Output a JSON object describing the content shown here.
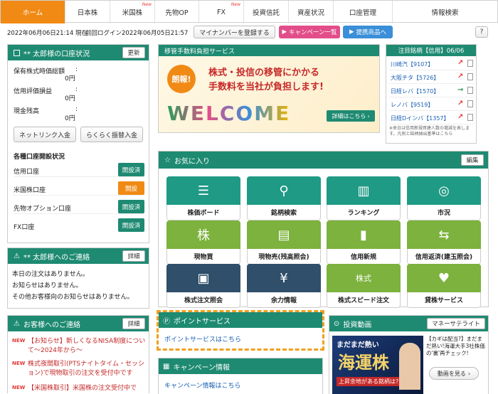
{
  "nav": {
    "tabs": [
      {
        "label": "ホーム",
        "new": ""
      },
      {
        "label": "日本株",
        "new": ""
      },
      {
        "label": "米国株",
        "new": "New"
      },
      {
        "label": "先物OP",
        "new": ""
      },
      {
        "label": "FX",
        "new": "New"
      },
      {
        "label": "投資信託",
        "new": ""
      },
      {
        "label": "資産状況",
        "new": ""
      },
      {
        "label": "口座管理",
        "new": ""
      },
      {
        "label": "情報検索",
        "new": ""
      }
    ]
  },
  "status": {
    "datetime": "2022年06月06日21:14 現在",
    "last_login": "前回ログイン2022年06月05日21:57"
  },
  "header_buttons": {
    "mynumber": "マイナンバーを登録する",
    "campaign": "キャンペーン一覧",
    "partner": "提携商品へ",
    "help": "?"
  },
  "account": {
    "title": "** 太郎様の口座状況",
    "refresh": "更新",
    "rows": [
      {
        "label": "保有株式時価総額",
        "value": "0円"
      },
      {
        "label": "信用評価損益",
        "value": "0円"
      },
      {
        "label": "現金残高",
        "value": "0円"
      }
    ],
    "btn_netlink": "ネットリンク入金",
    "btn_easy": "らくらく振替入金",
    "open_title": "各種口座開設状況",
    "open_rows": [
      {
        "label": "信用口座",
        "status": "開設済",
        "color": "#1e8a72"
      },
      {
        "label": "米国株口座",
        "status": "開設",
        "color": "#f08a15"
      },
      {
        "label": "先物オプション口座",
        "status": "開設済",
        "color": "#1e8a72"
      },
      {
        "label": "FX口座",
        "status": "開設済",
        "color": "#1e8a72"
      }
    ]
  },
  "contact": {
    "title": "** 太郎様へのご連絡",
    "detail": "詳細",
    "lines": [
      "本日の注文はありません。",
      "お知らせはありません。",
      "その他お客様向のお知らせはありません。"
    ]
  },
  "customer": {
    "title": "お客様へのご連絡",
    "detail": "詳細",
    "items": [
      {
        "tag": "NEW",
        "text": "【お知らせ】新しくなるNISA制度について～2024年から～"
      },
      {
        "tag": "NEW",
        "text": "株式夜間取引(PTSナイトタイム・セッション)で現物取引の注文を受付中です"
      },
      {
        "tag": "NEW",
        "text": "【米国株取引】米国株の注文受付中で"
      }
    ]
  },
  "banner": {
    "header": "移管手数料負担サービス",
    "badge": "朗報!",
    "line1": "株式・投信の移管にかかる",
    "line2": "手数料を当社が負担します!",
    "welcome": "WELCOME",
    "detail": "詳細はこちら"
  },
  "watch": {
    "title": "注目銘柄【信用】06/06",
    "items": [
      {
        "name": "川崎汽【9107】",
        "dir": "up"
      },
      {
        "name": "大阪チタ【5726】",
        "dir": "up"
      },
      {
        "name": "日経レバ【1570】",
        "dir": "right"
      },
      {
        "name": "レノバ【9519】",
        "dir": "up"
      },
      {
        "name": "日経Dインバ【1357】",
        "dir": "up"
      }
    ],
    "note": "※来日は信用新規買建人数の増減を表します。凡例と銘柄抽出基準はこちら"
  },
  "favorites": {
    "title": "お気に入り",
    "edit": "編集",
    "items": [
      {
        "label": "株価ボード",
        "icon": "☰",
        "color": "teal"
      },
      {
        "label": "銘柄検索",
        "icon": "⚲",
        "color": "teal"
      },
      {
        "label": "ランキング",
        "icon": "▥",
        "color": "teal"
      },
      {
        "label": "市況",
        "icon": "◎",
        "color": "teal"
      },
      {
        "label": "現物買",
        "icon": "株",
        "color": "green"
      },
      {
        "label": "現物売(残高照会)",
        "icon": "▤",
        "color": "green"
      },
      {
        "label": "信用新規",
        "icon": "▮",
        "color": "green"
      },
      {
        "label": "信用返済(建玉照会)",
        "icon": "⇆",
        "color": "green"
      },
      {
        "label": "株式注文照会",
        "icon": "▣",
        "color": "navy"
      },
      {
        "label": "余力情報",
        "icon": "¥",
        "color": "navy"
      },
      {
        "label": "株式スピード注文",
        "icon": "株式",
        "color": "green"
      },
      {
        "label": "貸株サービス",
        "icon": "♥",
        "color": "green"
      }
    ]
  },
  "points": {
    "title": "ポイントサービス",
    "link": "ポイントサービスはこちら"
  },
  "campaign_info": {
    "title": "キャンペーン情報",
    "link": "キャンペーン情報はこちら"
  },
  "video": {
    "title": "投資動画",
    "satellite": "マネーサテライト",
    "caption": "【カギは配当?】まだまだ熱い!海運大手3社株価の'裏'再チェック!",
    "play": "動画を見る",
    "thumb_top": "まだまだ熱い",
    "thumb_main": "海運株",
    "thumb_sub": "上昇余地がある銘柄は?"
  }
}
